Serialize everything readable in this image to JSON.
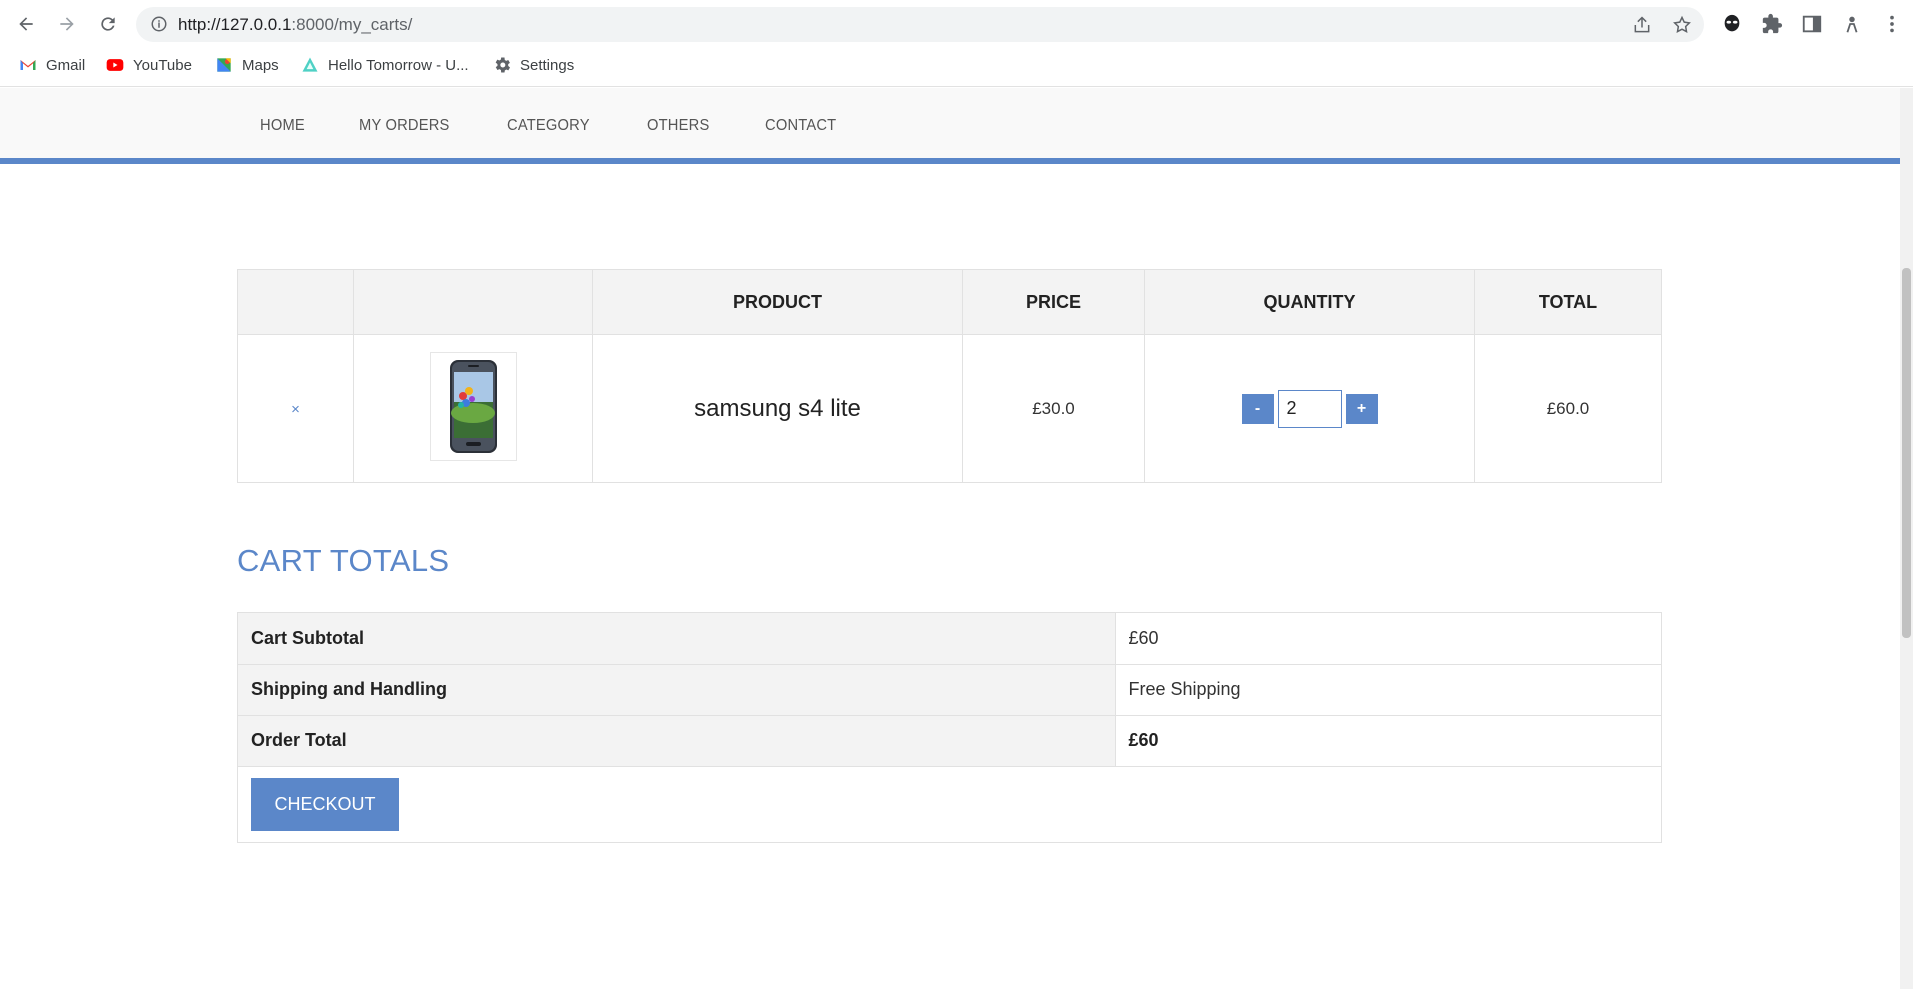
{
  "browser": {
    "url_host": "http://127.0.0.1",
    "url_path": ":8000/my_carts/",
    "bookmarks": [
      {
        "label": "Gmail",
        "icon": "gmail-icon"
      },
      {
        "label": "YouTube",
        "icon": "youtube-icon"
      },
      {
        "label": "Maps",
        "icon": "maps-icon"
      },
      {
        "label": "Hello Tomorrow - U...",
        "icon": "hello-tomorrow-icon"
      },
      {
        "label": "Settings",
        "icon": "gear-icon"
      }
    ]
  },
  "nav": {
    "items": [
      "HOME",
      "MY ORDERS",
      "CATEGORY",
      "OTHERS",
      "CONTACT"
    ]
  },
  "cart": {
    "headers": [
      "",
      "",
      "PRODUCT",
      "PRICE",
      "QUANTITY",
      "TOTAL"
    ],
    "rows": [
      {
        "remove": "×",
        "product": "samsung s4 lite",
        "price": "£30.0",
        "quantity": "2",
        "minus": "-",
        "plus": "+",
        "total": "£60.0"
      }
    ]
  },
  "totals": {
    "title": "CART TOTALS",
    "subtotal_label": "Cart Subtotal",
    "subtotal_value": "£60",
    "shipping_label": "Shipping and Handling",
    "shipping_value": "Free Shipping",
    "order_total_label": "Order Total",
    "order_total_value": "£60",
    "checkout_label": "CHECKOUT"
  },
  "colors": {
    "accent": "#5b87c9",
    "header_bg": "#f9f9f9",
    "table_header_bg": "#f3f3f3"
  }
}
